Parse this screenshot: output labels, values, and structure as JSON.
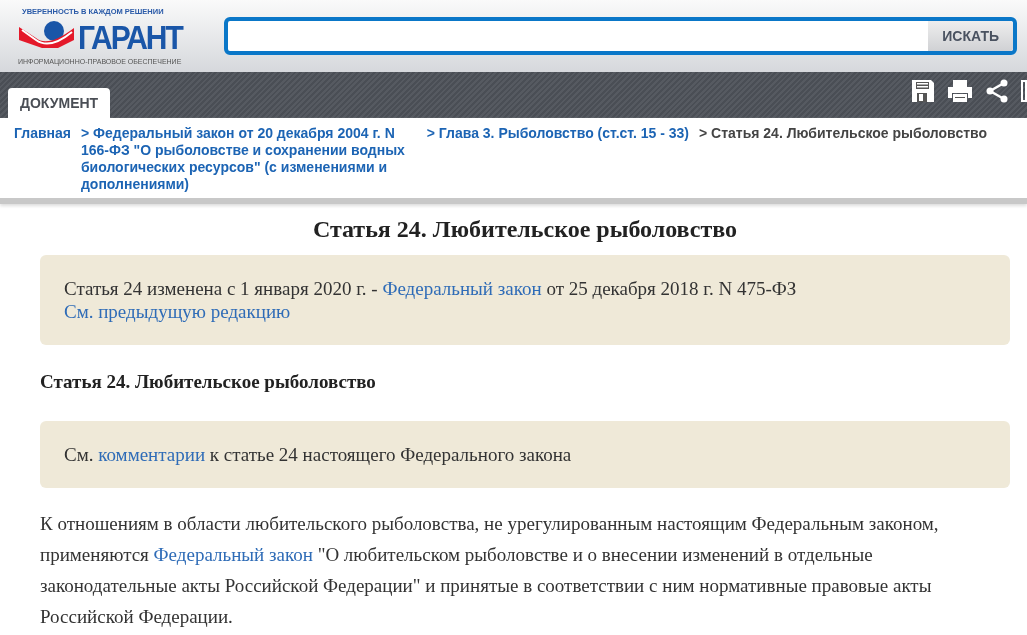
{
  "logo": {
    "slogan": "УВЕРЕННОСТЬ В КАЖДОМ РЕШЕНИИ",
    "wordmark": "ГАРАНТ",
    "subtitle": "ИНФОРМАЦИОННО-ПРАВОВОЕ ОБЕСПЕЧЕНИЕ"
  },
  "search": {
    "button": "ИСКАТЬ"
  },
  "tabs": [
    {
      "label": "ДОКУМЕНТ",
      "selected": true
    }
  ],
  "breadcrumbs": [
    {
      "text": "Главная",
      "current": false
    },
    {
      "text": "> Федеральный закон от 20 декабря 2004 г. N 166-ФЗ \"О рыболовстве и сохранении водных биологических ресурсов\" (с изменениями и дополнениями)",
      "current": false
    },
    {
      "text": "> Глава 3. Рыболовство (ст.ст. 15 - 33)",
      "current": false
    },
    {
      "text": "> Статья 24. Любительское рыболовство",
      "current": true
    }
  ],
  "title": "Статья 24. Любительское рыболовство",
  "blocks": [
    {
      "kind": "notice",
      "lines": [
        [
          {
            "text": "Статья 24 изменена с 1 января 2020 г. - ",
            "link": false
          },
          {
            "text": "Федеральный закон",
            "link": true
          },
          {
            "text": " от 25 декабря 2018 г. N 475-ФЗ",
            "link": false
          }
        ],
        [
          {
            "text": "См. предыдущую редакцию",
            "link": true
          }
        ]
      ]
    },
    {
      "kind": "heading",
      "text": "Статья 24. Любительское рыболовство"
    },
    {
      "kind": "notice",
      "lines": [
        [
          {
            "text": "См. ",
            "link": false
          },
          {
            "text": "комментарии",
            "link": true
          },
          {
            "text": " к статье 24 настоящего Федерального закона",
            "link": false
          }
        ]
      ]
    },
    {
      "kind": "paragraph",
      "lines": [
        [
          {
            "text": "К отношениям в области любительского рыболовства, не урегулированным настоящим Федеральным законом, применяются ",
            "link": false
          },
          {
            "text": "Федеральный закон",
            "link": true
          },
          {
            "text": " \"О любительском рыболовстве и о внесении изменений в отдельные законодательные акты Российской Федерации\" и принятые в соответствии с ним нормативные правовые акты Российской Федерации.",
            "link": false
          }
        ]
      ]
    }
  ]
}
